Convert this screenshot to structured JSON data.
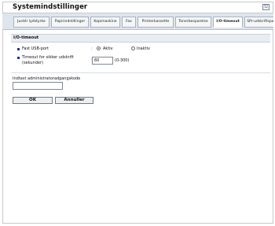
{
  "app": {
    "title": "Systemindstillinger",
    "exit_glyph": "⎋"
  },
  "tabs": [
    {
      "label": "Justér lydstyrke"
    },
    {
      "label": "Papirindstillinger"
    },
    {
      "label": "Kopimaskine"
    },
    {
      "label": "Fax"
    },
    {
      "label": "Printerkassette"
    },
    {
      "label": "Tonerbesparelse"
    },
    {
      "label": "I/O-timeout"
    },
    {
      "label": "SPr-udskriftsparam"
    }
  ],
  "section": {
    "title": "I/O-timeout",
    "fast_usb": {
      "label": "Fast USB-port",
      "colon": ":",
      "options": [
        {
          "label": "Aktiv",
          "selected": true
        },
        {
          "label": "Inaktiv",
          "selected": false
        }
      ]
    },
    "timeout": {
      "label_line1": "Timeout for sikker udskrift",
      "label_line2": "(sekunder)",
      "colon": ":",
      "value": "60",
      "range": "(0-300)"
    }
  },
  "admin": {
    "label": "Indtast administratoradgangskode",
    "value": ""
  },
  "buttons": {
    "ok": "OK",
    "cancel": "Annuller"
  },
  "colors": {
    "accent": "#1b3a8a",
    "tabbar": "#dfe5ec"
  }
}
